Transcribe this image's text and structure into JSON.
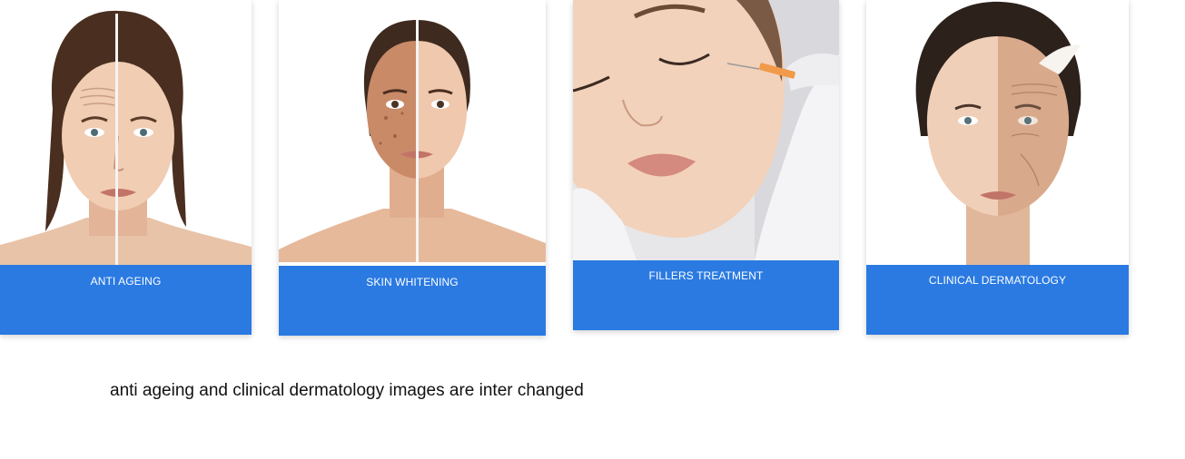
{
  "cards": [
    {
      "label": "ANTI AGEING",
      "image_icon": "split-face-wrinkles-image"
    },
    {
      "label": "SKIN WHITENING",
      "image_icon": "split-face-pigmentation-image"
    },
    {
      "label": "FILLERS TREATMENT",
      "image_icon": "face-injection-image"
    },
    {
      "label": "CLINICAL DERMATOLOGY",
      "image_icon": "split-face-aged-peel-image"
    }
  ],
  "note": "anti ageing and clinical dermatology images are inter changed",
  "colors": {
    "label_bar": "#2a7ae2",
    "label_text": "#ffffff",
    "note_text": "#111111"
  }
}
